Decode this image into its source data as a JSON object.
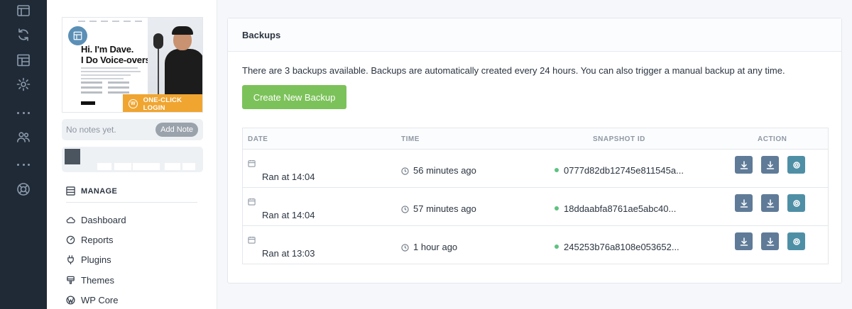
{
  "rail": {
    "icons": [
      "layout-icon",
      "refresh-icon",
      "template-icon",
      "gear-icon",
      "more-dots-icon",
      "users-icon",
      "more-dots-icon",
      "lifebuoy-icon"
    ]
  },
  "site": {
    "hero_line1": "Hi. I'm Dave.",
    "hero_line2": "I Do Voice-overs.",
    "one_click_label": "ONE-CLICK LOGIN",
    "notes_text": "No notes yet.",
    "add_note_label": "Add Note"
  },
  "manage": {
    "heading": "MANAGE",
    "items": [
      {
        "label": "Dashboard",
        "icon": "cloud-icon"
      },
      {
        "label": "Reports",
        "icon": "gauge-icon"
      },
      {
        "label": "Plugins",
        "icon": "plug-icon"
      },
      {
        "label": "Themes",
        "icon": "brush-icon"
      },
      {
        "label": "WP Core",
        "icon": "wordpress-icon"
      }
    ]
  },
  "backups": {
    "title": "Backups",
    "description": "There are 3 backups available. Backups are automatically created every 24 hours. You can also trigger a manual backup at any time.",
    "create_label": "Create New Backup",
    "columns": {
      "date": "DATE",
      "time": "TIME",
      "snapshot": "SNAPSHOT ID",
      "action": "ACTION"
    },
    "status_color": "#5cc281",
    "rows": [
      {
        "date": "Ran at 14:04",
        "time": "56 minutes ago",
        "snapshot": "0777d82db12745e811545a..."
      },
      {
        "date": "Ran at 14:04",
        "time": "57 minutes ago",
        "snapshot": "18ddaabfa8761ae5abc40..."
      },
      {
        "date": "Ran at 13:03",
        "time": "1 hour ago",
        "snapshot": "245253b76a8108e053652..."
      }
    ]
  }
}
